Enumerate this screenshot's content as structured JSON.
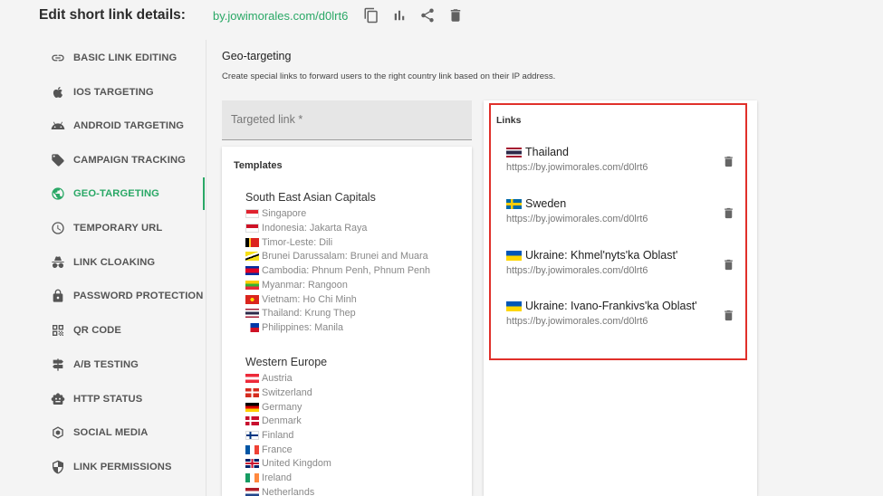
{
  "header": {
    "title": "Edit short link details:",
    "short_url": "by.jowimorales.com/d0lrt6",
    "icons": [
      "copy-icon",
      "bar-chart-icon",
      "share-icon",
      "trash-icon"
    ]
  },
  "sidebar": {
    "active": "GEO-TARGETING",
    "items": [
      {
        "label": "BASIC LINK EDITING",
        "icon": "link-icon"
      },
      {
        "label": "IOS TARGETING",
        "icon": "apple-icon"
      },
      {
        "label": "ANDROID TARGETING",
        "icon": "android-icon"
      },
      {
        "label": "CAMPAIGN TRACKING",
        "icon": "tag-icon"
      },
      {
        "label": "GEO-TARGETING",
        "icon": "globe-icon"
      },
      {
        "label": "TEMPORARY URL",
        "icon": "clock-icon"
      },
      {
        "label": "LINK CLOAKING",
        "icon": "incognito-icon"
      },
      {
        "label": "PASSWORD PROTECTION",
        "icon": "lock-icon"
      },
      {
        "label": "QR CODE",
        "icon": "qr-code-icon"
      },
      {
        "label": "A/B TESTING",
        "icon": "signpost-icon"
      },
      {
        "label": "HTTP STATUS",
        "icon": "robot-icon"
      },
      {
        "label": "SOCIAL MEDIA",
        "icon": "hexagon-icon"
      },
      {
        "label": "LINK PERMISSIONS",
        "icon": "shield-icon"
      }
    ]
  },
  "main": {
    "title": "Geo-targeting",
    "description": "Create special links to forward users to the right country link based on their IP address.",
    "targeted_link_placeholder": "Targeted link *",
    "templates": {
      "heading": "Templates",
      "groups": [
        {
          "title": "South East Asian Capitals",
          "items": [
            {
              "label": "Singapore",
              "flag": "sg"
            },
            {
              "label": "Indonesia: Jakarta Raya",
              "flag": "id"
            },
            {
              "label": "Timor-Leste: Dili",
              "flag": "tl"
            },
            {
              "label": "Brunei Darussalam: Brunei and Muara",
              "flag": "bn"
            },
            {
              "label": "Cambodia: Phnum Penh, Phnum Penh",
              "flag": "kh"
            },
            {
              "label": "Myanmar: Rangoon",
              "flag": "mm"
            },
            {
              "label": "Vietnam: Ho Chi Minh",
              "flag": "vn"
            },
            {
              "label": "Thailand: Krung Thep",
              "flag": "th"
            },
            {
              "label": "Philippines: Manila",
              "flag": "ph"
            }
          ]
        },
        {
          "title": "Western Europe",
          "items": [
            {
              "label": "Austria",
              "flag": "at"
            },
            {
              "label": "Switzerland",
              "flag": "ch"
            },
            {
              "label": "Germany",
              "flag": "de"
            },
            {
              "label": "Denmark",
              "flag": "dk"
            },
            {
              "label": "Finland",
              "flag": "fi"
            },
            {
              "label": "France",
              "flag": "fr"
            },
            {
              "label": "United Kingdom",
              "flag": "gb"
            },
            {
              "label": "Ireland",
              "flag": "ie"
            },
            {
              "label": "Netherlands",
              "flag": "nl"
            }
          ]
        }
      ]
    },
    "links": {
      "heading": "Links",
      "items": [
        {
          "country": "Thailand",
          "flag": "th",
          "url": "https://by.jowimorales.com/d0lrt6"
        },
        {
          "country": "Sweden",
          "flag": "se",
          "url": "https://by.jowimorales.com/d0lrt6"
        },
        {
          "country": "Ukraine: Khmel'nyts'ka Oblast'",
          "flag": "ua",
          "url": "https://by.jowimorales.com/d0lrt6"
        },
        {
          "country": "Ukraine: Ivano-Frankivs'ka Oblast'",
          "flag": "ua",
          "url": "https://by.jowimorales.com/d0lrt6"
        }
      ]
    }
  }
}
